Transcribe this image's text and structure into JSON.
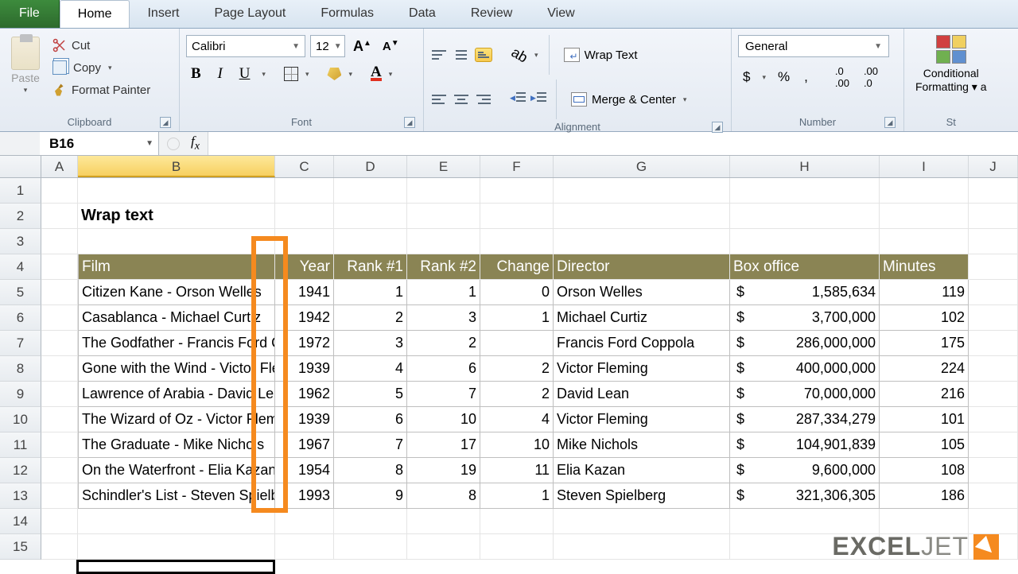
{
  "tabs": {
    "file": "File",
    "home": "Home",
    "insert": "Insert",
    "pagelayout": "Page Layout",
    "formulas": "Formulas",
    "data": "Data",
    "review": "Review",
    "view": "View"
  },
  "clipboard": {
    "paste": "Paste",
    "cut": "Cut",
    "copy": "Copy",
    "format_painter": "Format Painter",
    "group": "Clipboard"
  },
  "font": {
    "name": "Calibri",
    "size": "12",
    "group": "Font"
  },
  "alignment": {
    "wrap": "Wrap Text",
    "merge": "Merge & Center",
    "group": "Alignment"
  },
  "number": {
    "format": "General",
    "group": "Number"
  },
  "styles": {
    "cond": "Conditional",
    "fmt": "Formatting",
    "group": "St"
  },
  "namebox": "B16",
  "sheet": {
    "title": "Wrap text",
    "headers": {
      "film": "Film",
      "year": "Year",
      "rank1": "Rank #1",
      "rank2": "Rank #2",
      "change": "Change",
      "director": "Director",
      "boxoffice": "Box office",
      "minutes": "Minutes"
    },
    "rows": [
      {
        "film": "Citizen Kane - Orson Welles",
        "year": "1941",
        "r1": "1",
        "r2": "1",
        "ch": "0",
        "dir": "Orson Welles",
        "box": "1,585,634",
        "min": "119"
      },
      {
        "film": "Casablanca - Michael Curtiz",
        "year": "1942",
        "r1": "2",
        "r2": "3",
        "ch": "1",
        "dir": "Michael Curtiz",
        "box": "3,700,000",
        "min": "102"
      },
      {
        "film": "The Godfather - Francis Ford Coppola",
        "year": "1972",
        "r1": "3",
        "r2": "2",
        "ch": "",
        "dir": "Francis Ford Coppola",
        "box": "286,000,000",
        "min": "175"
      },
      {
        "film": "Gone with the Wind - Victor Fleming",
        "year": "1939",
        "r1": "4",
        "r2": "6",
        "ch": "2",
        "dir": "Victor Fleming",
        "box": "400,000,000",
        "min": "224"
      },
      {
        "film": "Lawrence of Arabia - David Lean",
        "year": "1962",
        "r1": "5",
        "r2": "7",
        "ch": "2",
        "dir": "David Lean",
        "box": "70,000,000",
        "min": "216"
      },
      {
        "film": "The Wizard of Oz - Victor Fleming",
        "year": "1939",
        "r1": "6",
        "r2": "10",
        "ch": "4",
        "dir": "Victor Fleming",
        "box": "287,334,279",
        "min": "101"
      },
      {
        "film": "The Graduate - Mike Nichols",
        "year": "1967",
        "r1": "7",
        "r2": "17",
        "ch": "10",
        "dir": "Mike Nichols",
        "box": "104,901,839",
        "min": "105"
      },
      {
        "film": "On the Waterfront - Elia Kazan",
        "year": "1954",
        "r1": "8",
        "r2": "19",
        "ch": "11",
        "dir": "Elia Kazan",
        "box": "9,600,000",
        "min": "108"
      },
      {
        "film": "Schindler's List - Steven Spielberg",
        "year": "1993",
        "r1": "9",
        "r2": "8",
        "ch": "1",
        "dir": "Steven Spielberg",
        "box": "321,306,305",
        "min": "186"
      }
    ]
  },
  "watermark": {
    "a": "EXCEL",
    "b": "JET"
  },
  "cols": [
    "A",
    "B",
    "C",
    "D",
    "E",
    "F",
    "G",
    "H",
    "I",
    "J"
  ],
  "rownums": [
    "1",
    "2",
    "3",
    "4",
    "5",
    "6",
    "7",
    "8",
    "9",
    "10",
    "11",
    "12",
    "13",
    "14",
    "15"
  ]
}
